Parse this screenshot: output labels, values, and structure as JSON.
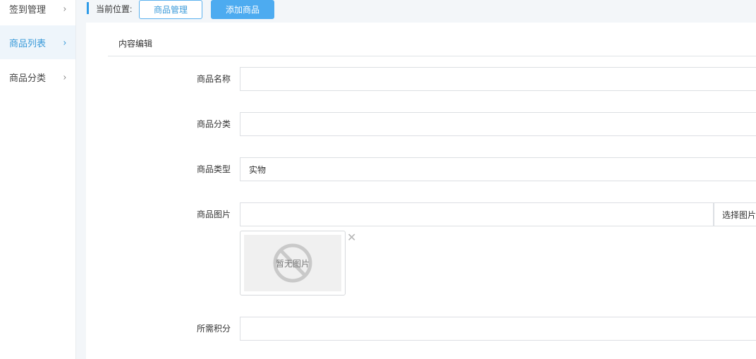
{
  "sidebar": {
    "items": [
      {
        "label": "签到管理",
        "active": false
      },
      {
        "label": "商品列表",
        "active": true
      },
      {
        "label": "商品分类",
        "active": false
      }
    ],
    "chevron": "›"
  },
  "breadcrumb": {
    "label": "当前位置:",
    "parent": "商品管理",
    "current": "添加商品"
  },
  "section": {
    "title": "内容编辑"
  },
  "form": {
    "name": {
      "label": "商品名称",
      "value": ""
    },
    "category": {
      "label": "商品分类",
      "value": ""
    },
    "type": {
      "label": "商品类型",
      "value": "实物"
    },
    "image": {
      "label": "商品图片",
      "value": "",
      "button": "选择图片",
      "placeholder_text": "暂无图片",
      "remove": "✕"
    },
    "points": {
      "label": "所需积分",
      "value": ""
    }
  },
  "colors": {
    "accent": "#3a9ad9",
    "primary_button": "#4dabf0"
  },
  "icons": {
    "no-image": "no-image-icon",
    "remove": "close-icon",
    "chevron": "chevron-right-icon"
  }
}
